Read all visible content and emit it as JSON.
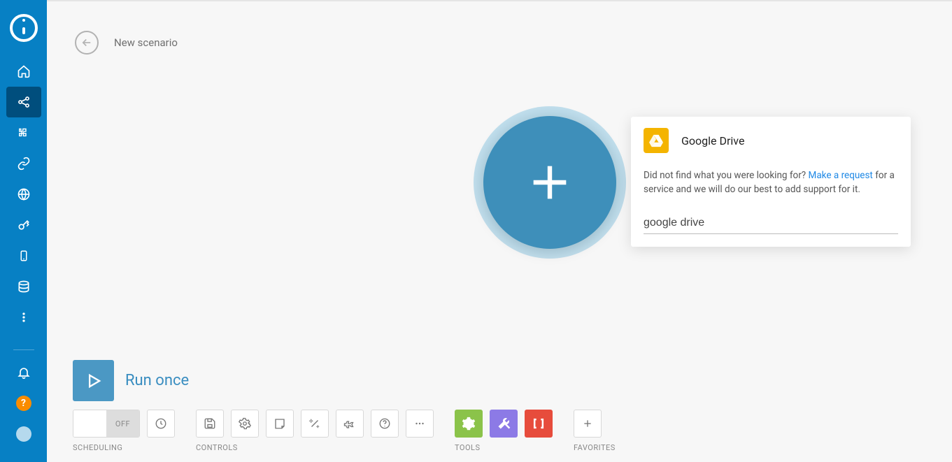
{
  "header": {
    "title": "New scenario"
  },
  "popup": {
    "result_label": "Google Drive",
    "text_prefix": "Did not find what you were looking for? ",
    "link_text": "Make a request",
    "text_suffix": " for a service and we will do our best to add support for it.",
    "search_value": "google drive"
  },
  "run": {
    "label": "Run once"
  },
  "toolbar": {
    "scheduling_label": "SCHEDULING",
    "off_label": "OFF",
    "controls_label": "CONTROLS",
    "tools_label": "TOOLS",
    "favorites_label": "FAVORITES"
  },
  "icons": {
    "help": "?"
  }
}
